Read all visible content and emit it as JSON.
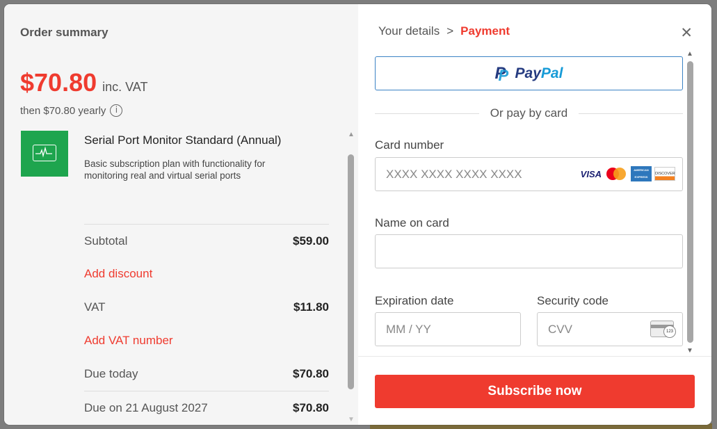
{
  "summary": {
    "title": "Order summary",
    "price": "$70.80",
    "price_suffix": "inc. VAT",
    "then": "then $70.80 yearly",
    "info_glyph": "i",
    "product": {
      "name": "Serial Port Monitor Standard (Annual)",
      "description": "Basic subscription plan with functionality for monitoring real and virtual serial ports",
      "icon": "monitor-pulse-icon",
      "icon_color": "#1ea54e"
    },
    "subtotal_label": "Subtotal",
    "subtotal_value": "$59.00",
    "add_discount": "Add discount",
    "vat_label": "VAT",
    "vat_value": "$11.80",
    "add_vat_number": "Add VAT number",
    "due_today_label": "Due today",
    "due_today_value": "$70.80",
    "due_later_label": "Due on 21 August 2027",
    "due_later_value": "$70.80"
  },
  "checkout": {
    "breadcrumb_step1": "Your details",
    "breadcrumb_sep": ">",
    "breadcrumb_step2": "Payment",
    "close_glyph": "✕",
    "paypal_pay": "Pay",
    "paypal_pal": "Pal",
    "divider_text": "Or pay by card",
    "card_number_label": "Card number",
    "card_number_placeholder": "XXXX XXXX XXXX XXXX",
    "card_brands": {
      "visa": "VISA",
      "amex": "AMERICAN EXPRESS",
      "discover": "DISCOVER"
    },
    "name_label": "Name on card",
    "name_placeholder": "",
    "expiry_label": "Expiration date",
    "expiry_placeholder": "MM / YY",
    "security_label": "Security code",
    "security_placeholder": "CVV",
    "cvv_badge": "123",
    "subscribe_label": "Subscribe now"
  },
  "colors": {
    "accent": "#ef3b2f",
    "paypal_border": "#3b82c4",
    "paypal_dark": "#253b80",
    "paypal_light": "#179bd7"
  }
}
